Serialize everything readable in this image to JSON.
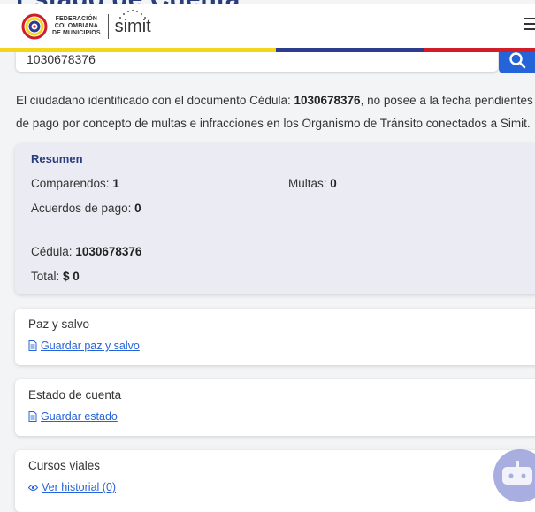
{
  "page": {
    "title": "Estado de Cuenta"
  },
  "header": {
    "logo_lines": [
      "FEDERACIÓN",
      "COLOMBIANA",
      "DE MUNICIPIOS"
    ],
    "brand": "simit",
    "colors": {
      "yellow": "#f4d51b",
      "blue": "#2d3c8c",
      "red": "#d11d27",
      "accent": "#2563d8"
    }
  },
  "search": {
    "value": "1030678376",
    "icon": "search-icon"
  },
  "message": {
    "prefix": "El ciudadano identificado con el documento Cédula: ",
    "document": "1030678376",
    "suffix": ", no posee a la fecha pendientes de pago por concepto de multas e infracciones en los Organismo de Tránsito conectados a Simit."
  },
  "resumen": {
    "title": "Resumen",
    "comparendos_label": "Comparendos:",
    "comparendos_value": "1",
    "multas_label": "Multas:",
    "multas_value": "0",
    "acuerdos_label": "Acuerdos de pago:",
    "acuerdos_value": "0",
    "cedula_label": "Cédula:",
    "cedula_value": "1030678376",
    "total_label": "Total:",
    "total_value": "$ 0"
  },
  "cards": [
    {
      "title": "Paz y salvo",
      "link": "Guardar paz y salvo",
      "icon": "document-icon"
    },
    {
      "title": "Estado de cuenta",
      "link": "Guardar estado",
      "icon": "document-icon"
    },
    {
      "title": "Cursos viales",
      "link": "Ver historial (0)",
      "icon": "eye-icon"
    }
  ]
}
